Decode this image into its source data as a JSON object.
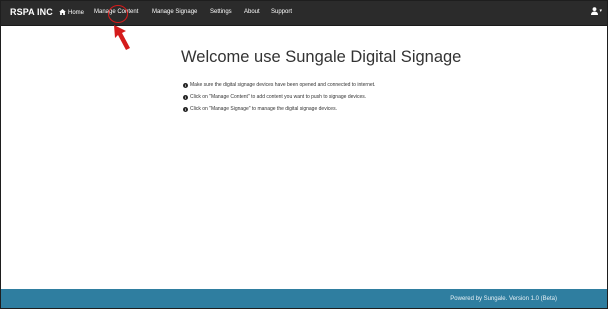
{
  "navbar": {
    "brand": "RSPA INC",
    "items": [
      {
        "label": "Home",
        "icon": "home-icon"
      },
      {
        "label": "Manage Content"
      },
      {
        "label": "Manage Signage"
      },
      {
        "label": "Settings"
      },
      {
        "label": "About"
      },
      {
        "label": "Support"
      }
    ],
    "user_menu": {
      "icon": "user-icon",
      "caret": "▾"
    }
  },
  "main": {
    "title": "Welcome use Sungale Digital Signage",
    "instructions": [
      "Make sure the digital signage devices have been opened and connected to internet.",
      "Click on \"Manage Content\" to add content you want to push to signage devices.",
      "Click on \"Manage Signage\" to manage the digital signage devices."
    ]
  },
  "footer": {
    "text": "Powered by Sungale. Version 1.0 (Beta)"
  },
  "colors": {
    "navbar_bg": "#2b2b2b",
    "footer_bg": "#2f7ea0",
    "annotation": "#d41b1b"
  }
}
